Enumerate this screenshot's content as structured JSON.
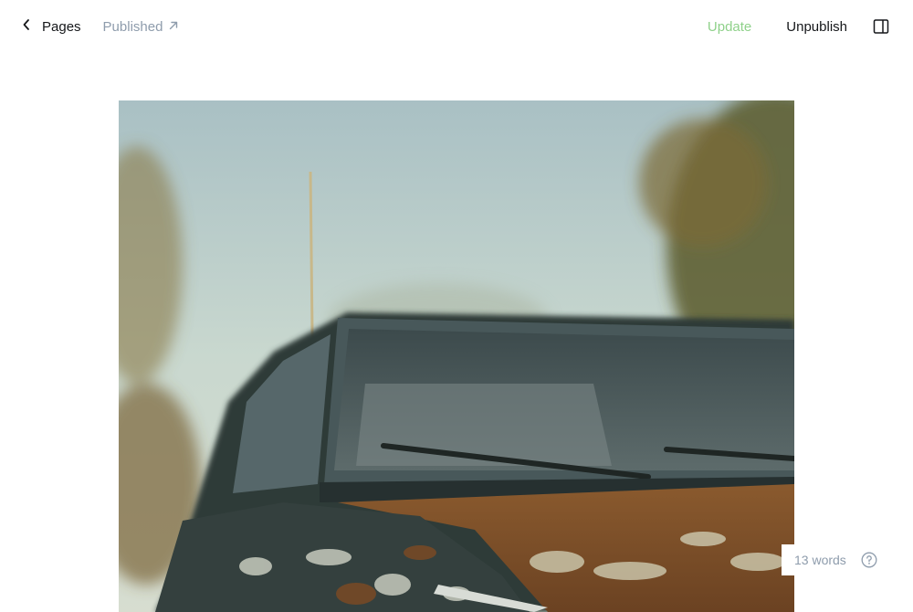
{
  "header": {
    "back_label": "Pages",
    "status_label": "Published",
    "update_label": "Update",
    "unpublish_label": "Unpublish"
  },
  "icons": {
    "back": "chevron-left-icon",
    "external": "arrow-up-right-icon",
    "sidebar": "sidebar-toggle-icon",
    "help": "question-circle-icon"
  },
  "colors": {
    "update_accent": "#8fd18a",
    "muted_text": "#8e9cac"
  },
  "footer": {
    "word_count": "13 words"
  }
}
